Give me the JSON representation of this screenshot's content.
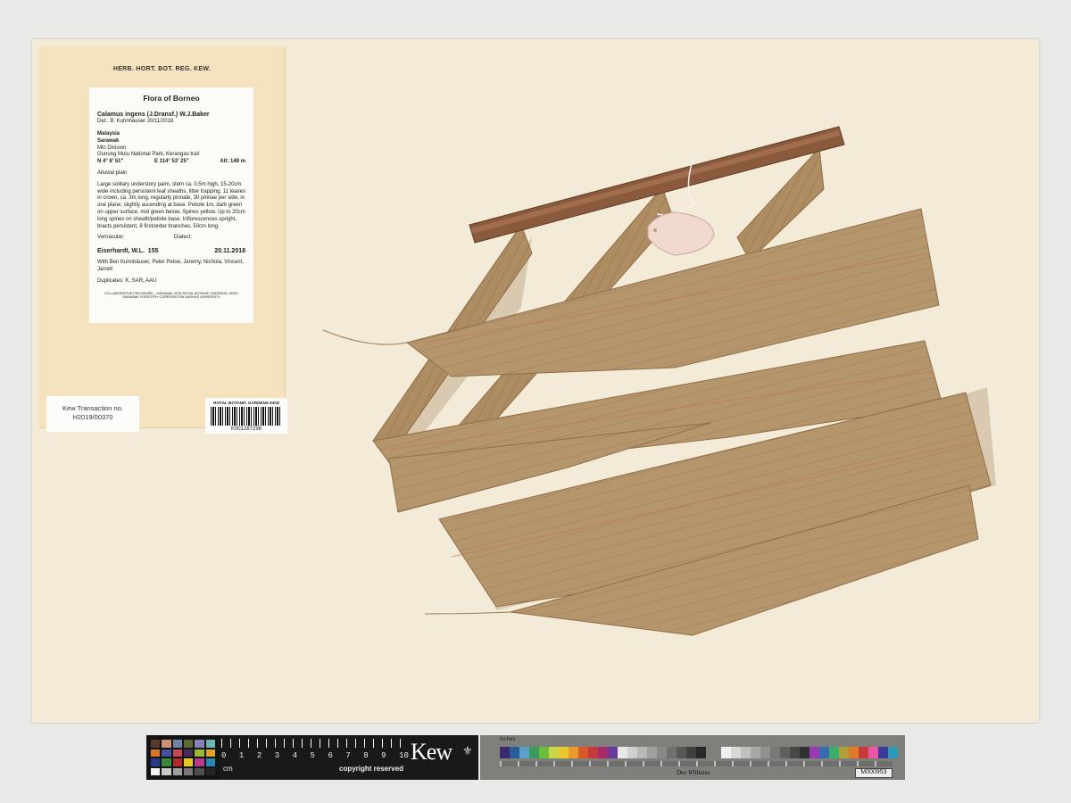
{
  "label": {
    "herbarium": "HERB. HORT. BOT. REG. KEW.",
    "flora": "Flora of Borneo",
    "taxon": "Calamus ingens (J.Dransf.) W.J.Baker",
    "determiner": "Det.: B. Kuhnhäuser 20/11/2018",
    "country": "Malaysia",
    "state": "Sarawak",
    "division": "Miri Division",
    "locality": "Gunung Mulu National Park, Kerangas trail",
    "latitude": "N 4° 8' 51\"",
    "longitude": "E 114° 53' 25\"",
    "altitude": "Alt: 149 m",
    "habitat": "Alluvial plain",
    "description": "Large solitary understory palm, stem ca. 0.5m high, 15-20cm wide including persistent leaf sheaths, litter trapping, 11 leaves in crown, ca. 3m long, regularly pinnate, 30 pinnae per side, in one plane, slightly ascending at base. Petiole 1m, dark green on upper surface, mid green below. Spines yellow. Up to 20cm long spines on sheath/petiole base. Inflorescences upright, bracts persistent, 8 first/order branches, 50cm long.",
    "vernacular": "Vernacular:",
    "dialect": "Dialect:",
    "collector": "Eiserhardt, W.L.",
    "number": "155",
    "date": "20.11.2018",
    "companions": "With Ben Kuhnhäuser, Peter Petoe, Jeremy, Nichola, Vincent, Jarrett",
    "duplicates": "Duplicates: K, SAR, AAU",
    "footer": "COLLABORATIVE FIELDWORK - SARAWAK 2018 ROYAL BOTANIC GARDENS, KEW | SARAWAK FORESTRY CORPORATION AARHUS UNIVERSITY"
  },
  "transaction": {
    "title": "Kew Transaction no.",
    "number": "H2019/00370"
  },
  "barcode": {
    "org": "ROYAL BOTANIC GARDENS KEW",
    "number": "K001287298"
  },
  "scale_bar": {
    "numbers": [
      "0",
      "1",
      "2",
      "3",
      "4",
      "5",
      "6",
      "7",
      "8",
      "9",
      "10"
    ],
    "unit": "cm",
    "copyright": "copyright reserved",
    "brand": "Kew",
    "inches_label": "inches",
    "signature": "Dee Williams",
    "code": "M000953"
  },
  "colors": {
    "sheet": "#f3ead7",
    "packet": "#f4e3be",
    "leaf": "#b5956c",
    "rachis": "#8a5a3c"
  },
  "checker_colors": [
    "#5a3a2a",
    "#c9907a",
    "#6d83a8",
    "#5a6b38",
    "#8a80b5",
    "#69b8b0",
    "#d8772a",
    "#43509a",
    "#c24a55",
    "#4a2b55",
    "#9cba3a",
    "#e3a32a",
    "#273a8c",
    "#3a8a3e",
    "#b02a2a",
    "#e6c82a",
    "#b83a8a",
    "#2a86b0",
    "#f2f2f2",
    "#c8c8c8",
    "#a0a0a0",
    "#787878",
    "#505050",
    "#262626"
  ],
  "swatch_colors": [
    "#3b2a6e",
    "#2b5c9a",
    "#5aa0c8",
    "#3a9a5a",
    "#6abf3a",
    "#c8d84a",
    "#e8c82a",
    "#e89a2a",
    "#d85a2a",
    "#c83a3a",
    "#a82a6a",
    "#6a3a9a",
    "#e8e8e8",
    "#d0d0d0",
    "#b8b8b8",
    "#a0a0a0",
    "#888888",
    "#707070",
    "#585858",
    "#404040",
    "#282828"
  ],
  "gray_colors": [
    "#f0f0f0",
    "#d8d8d8",
    "#c0c0c0",
    "#a8a8a8",
    "#909090",
    "#787878",
    "#606060",
    "#484848",
    "#303030",
    "#9a3ab0",
    "#3a6ab0",
    "#3ab06a",
    "#b0a03a",
    "#e07a2a",
    "#c83a3a",
    "#e858a8",
    "#3a3a9a",
    "#2a9ab8"
  ]
}
